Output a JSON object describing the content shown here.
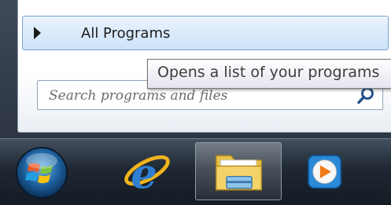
{
  "start_menu": {
    "all_programs_label": "All Programs",
    "search_placeholder": "Search programs and files",
    "icons": [
      "arrow-right-icon",
      "search-icon"
    ]
  },
  "tooltip": {
    "text": "Opens a list of your programs"
  },
  "taskbar": {
    "items": [
      {
        "name": "start-button",
        "icon": "windows-orb-icon"
      },
      {
        "name": "internet-explorer",
        "icon": "internet-explorer-icon"
      },
      {
        "name": "windows-explorer",
        "icon": "folder-icon",
        "active": true
      },
      {
        "name": "windows-media-player",
        "icon": "media-player-icon"
      }
    ]
  },
  "colors": {
    "taskbar": "#1f2833",
    "highlight_border": "#7da2ce",
    "highlight_fill": "#cde3fa",
    "tooltip_border": "#767676"
  }
}
